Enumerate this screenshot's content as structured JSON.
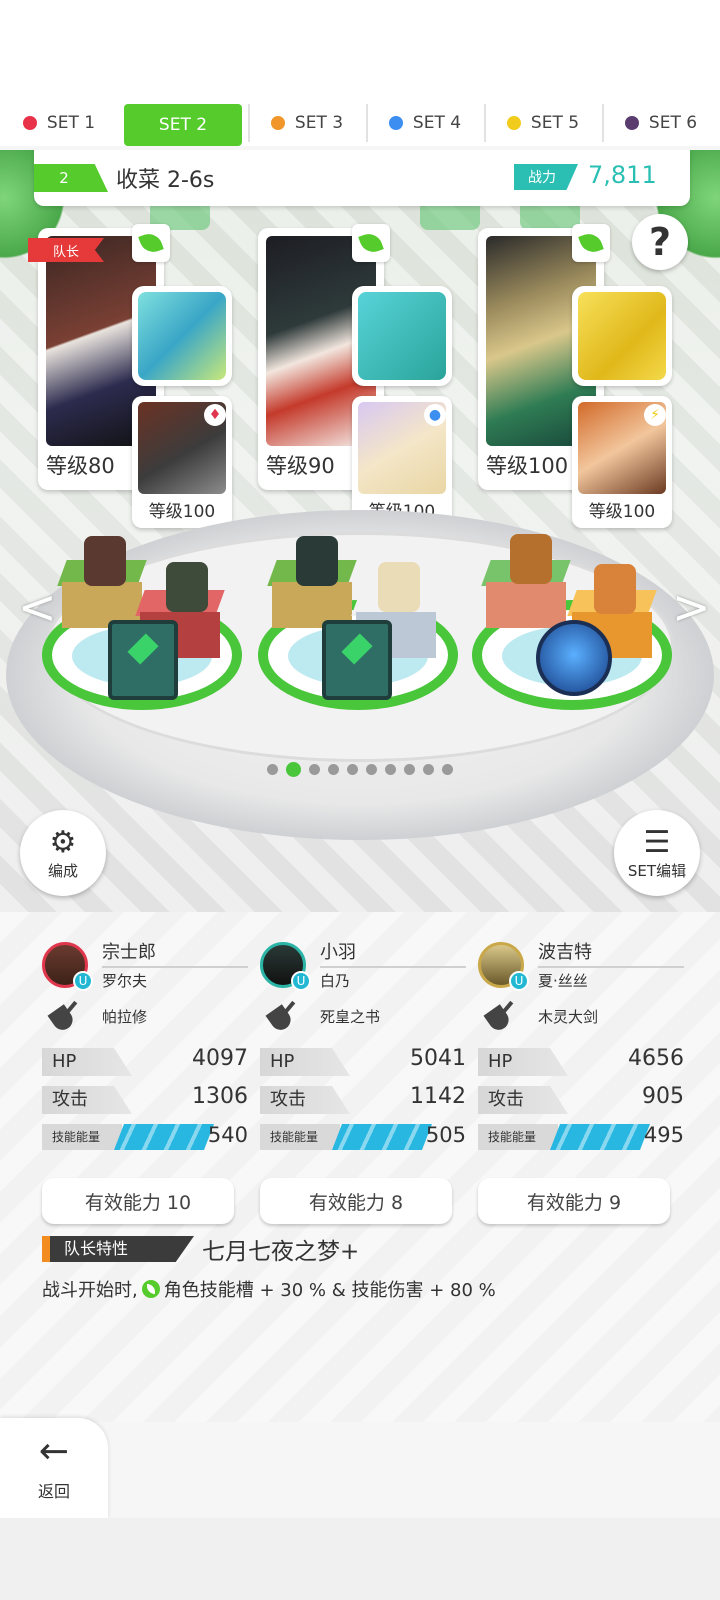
{
  "tabs": [
    {
      "label": "SET 1",
      "color": "#e8324a",
      "active": false
    },
    {
      "label": "SET 2",
      "color": "#55cc2c",
      "active": true
    },
    {
      "label": "SET 3",
      "color": "#f0962a",
      "active": false
    },
    {
      "label": "SET 4",
      "color": "#3c8ef0",
      "active": false
    },
    {
      "label": "SET 5",
      "color": "#f2cc1c",
      "active": false
    },
    {
      "label": "SET 6",
      "color": "#5a3c6e",
      "active": false
    }
  ],
  "stage": {
    "number": "2",
    "name": "收菜 2-6s",
    "power_label": "战力",
    "power_value": "7,811"
  },
  "heroes": [
    {
      "captain_tag": "队长",
      "level": "等级80",
      "sub_level": "等级100",
      "weapon_color": "#69d4d8",
      "sub_mark": "♦"
    },
    {
      "captain_tag": "",
      "level": "等级90",
      "sub_level": "等级100",
      "weapon_color": "#2bb4a6",
      "sub_mark": "●"
    },
    {
      "captain_tag": "",
      "level": "等级100",
      "sub_level": "等级100",
      "weapon_color": "#f2c81c",
      "sub_mark": "⚡"
    }
  ],
  "help_label": "?",
  "arrows": {
    "left": "<",
    "right": ">"
  },
  "pager": {
    "count": 10,
    "active": 1
  },
  "buttons": {
    "formation_label": "编成",
    "set_edit_label": "SET编辑",
    "back_label": "返回"
  },
  "stats": [
    {
      "name": "宗士郎",
      "sub": "罗尔夫",
      "weapon": "帕拉修",
      "hp_label": "HP",
      "hp": "4097",
      "atk_label": "攻击",
      "atk": "1306",
      "energy_label": "技能能量",
      "energy": "540",
      "eff": "有效能力 10",
      "avatar_border": "#e0374d"
    },
    {
      "name": "小羽",
      "sub": "白乃",
      "weapon": "死皇之书",
      "hp_label": "HP",
      "hp": "5041",
      "atk_label": "攻击",
      "atk": "1142",
      "energy_label": "技能能量",
      "energy": "505",
      "eff": "有效能力 8",
      "avatar_border": "#2bb4a6"
    },
    {
      "name": "波吉特",
      "sub": "夏·丝丝",
      "weapon": "木灵大剑",
      "hp_label": "HP",
      "hp": "4656",
      "atk_label": "攻击",
      "atk": "905",
      "energy_label": "技能能量",
      "energy": "495",
      "eff": "有效能力 9",
      "avatar_border": "#c9a84a"
    }
  ],
  "leader": {
    "tag": "队长特性",
    "skill": "七月七夜之梦+",
    "desc_prefix": "战斗开始时,",
    "desc_suffix": "角色技能槽 + 30 % & 技能伤害 + 80 %"
  }
}
